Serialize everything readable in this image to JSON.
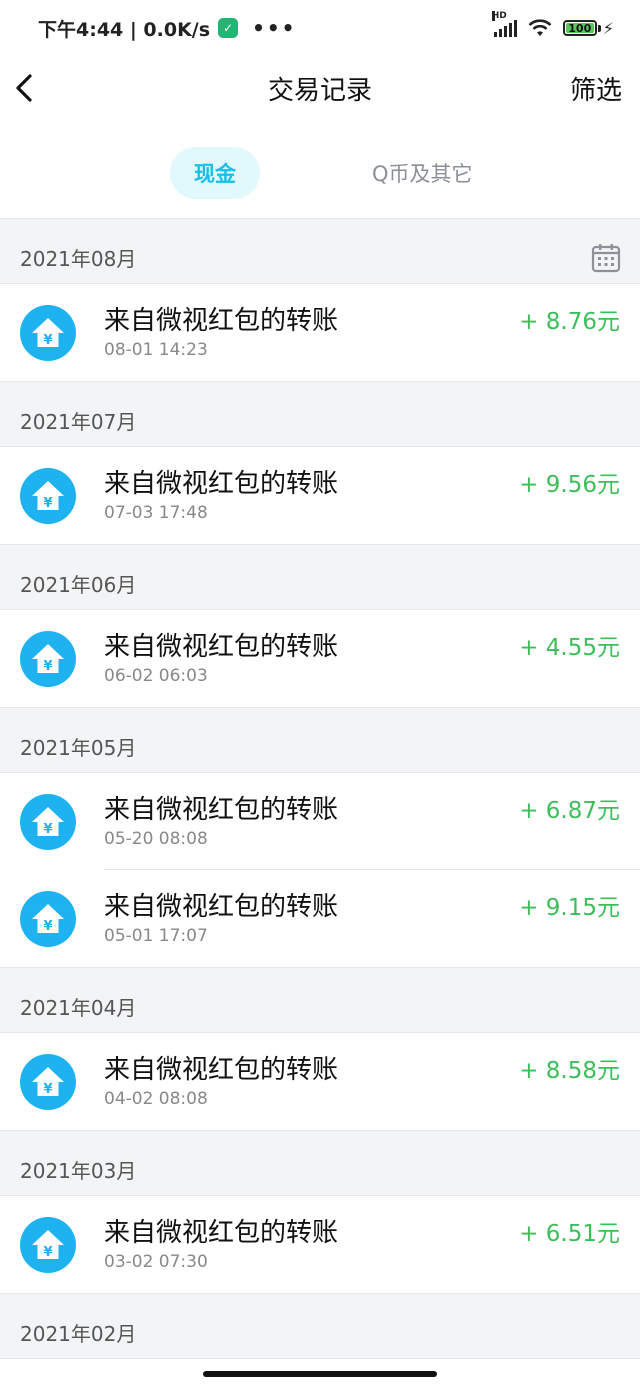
{
  "status_bar": {
    "time_speed": "下午4:44 | 0.0K/s",
    "dots": "•••",
    "hd": "HD",
    "battery": "100"
  },
  "header": {
    "title": "交易记录",
    "filter_label": "筛选"
  },
  "tabs": {
    "active": "现金",
    "other": "Q币及其它"
  },
  "colors": {
    "accent": "#17bfe8",
    "amount_green": "#3ebd5b",
    "icon_blue": "#1fb2f0",
    "section_bg": "#f3f4f6"
  },
  "sections": [
    {
      "month": "2021年08月",
      "items": [
        {
          "title": "来自微视红包的转账",
          "time": "08-01 14:23",
          "amount": "+ 8.76元"
        }
      ]
    },
    {
      "month": "2021年07月",
      "items": [
        {
          "title": "来自微视红包的转账",
          "time": "07-03 17:48",
          "amount": "+ 9.56元"
        }
      ]
    },
    {
      "month": "2021年06月",
      "items": [
        {
          "title": "来自微视红包的转账",
          "time": "06-02 06:03",
          "amount": "+ 4.55元"
        }
      ]
    },
    {
      "month": "2021年05月",
      "items": [
        {
          "title": "来自微视红包的转账",
          "time": "05-20 08:08",
          "amount": "+ 6.87元"
        },
        {
          "title": "来自微视红包的转账",
          "time": "05-01 17:07",
          "amount": "+ 9.15元"
        }
      ]
    },
    {
      "month": "2021年04月",
      "items": [
        {
          "title": "来自微视红包的转账",
          "time": "04-02 08:08",
          "amount": "+ 8.58元"
        }
      ]
    },
    {
      "month": "2021年03月",
      "items": [
        {
          "title": "来自微视红包的转账",
          "time": "03-02 07:30",
          "amount": "+ 6.51元"
        }
      ]
    },
    {
      "month": "2021年02月",
      "items": []
    }
  ]
}
